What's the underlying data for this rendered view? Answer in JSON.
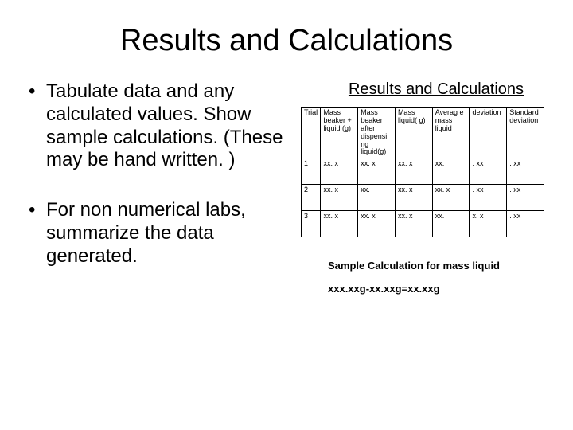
{
  "title": "Results and Calculations",
  "bullets": {
    "b1": "Tabulate data and any calculated values. Show sample calculations. (These may be hand written. )",
    "b2": "For non numerical labs, summarize the data generated."
  },
  "subheading": "Results and Calculations",
  "table": {
    "headers": {
      "h1": "Trial",
      "h2": "Mass beaker + liquid (g)",
      "h3": "Mass beaker after dispensi ng liquid(g)",
      "h4": "Mass liquid( g)",
      "h5": "Averag e mass liquid",
      "h6": "deviation",
      "h7": "Standard deviation"
    },
    "rows": [
      {
        "c1": "1",
        "c2": "xx. x",
        "c3": "xx. x",
        "c4": "xx. x",
        "c5": "xx.",
        "c6": ". xx",
        "c7": ". xx"
      },
      {
        "c1": "2",
        "c2": "xx. x",
        "c3": "xx.",
        "c4": "xx. x",
        "c5": "xx. x",
        "c6": ". xx",
        "c7": ". xx"
      },
      {
        "c1": "3",
        "c2": "xx. x",
        "c3": "xx. x",
        "c4": "xx. x",
        "c5": "xx.",
        "c6": "x. x",
        "c7": ". xx"
      }
    ]
  },
  "sample_calc": {
    "heading": "Sample Calculation for mass liquid",
    "formula": "xxx.xxg-xx.xxg=xx.xxg"
  }
}
